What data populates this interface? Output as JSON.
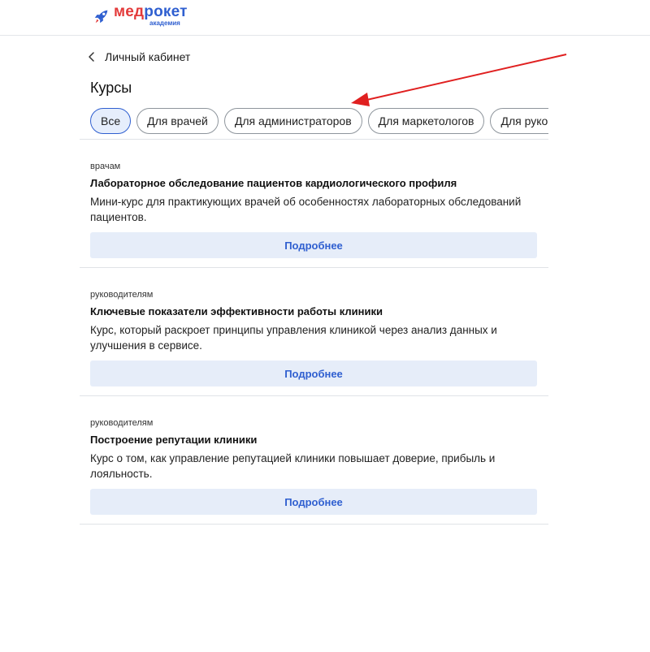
{
  "header": {
    "logo_med": "мед",
    "logo_roket": "рокет",
    "logo_sub": "академия"
  },
  "nav": {
    "back_label": "Личный кабинет"
  },
  "page": {
    "title": "Курсы"
  },
  "filters": [
    {
      "label": "Все",
      "active": true
    },
    {
      "label": "Для врачей",
      "active": false
    },
    {
      "label": "Для администраторов",
      "active": false
    },
    {
      "label": "Для маркетологов",
      "active": false
    },
    {
      "label": "Для руковод",
      "active": false
    }
  ],
  "courses": [
    {
      "tag": "врачам",
      "title": "Лабораторное обследование пациентов кардиологического профиля",
      "description": "Мини-курс для практикующих врачей об особенностях лабораторных обследований пациентов.",
      "button": "Подробнее"
    },
    {
      "tag": "руководителям",
      "title": "Ключевые показатели эффективности работы клиники",
      "description": "Курс, который раскроет принципы управления клиникой через анализ данных и улучшения в сервисе.",
      "button": "Подробнее"
    },
    {
      "tag": "руководителям",
      "title": "Построение репутации клиники",
      "description": "Курс о том, как управление репутацией клиники повышает доверие, прибыль и лояльность.",
      "button": "Подробнее"
    }
  ],
  "colors": {
    "accent": "#2f5fd0",
    "logo_red": "#e33a3a",
    "annotation_arrow": "#e02020",
    "button_bg": "#e6edf9"
  }
}
